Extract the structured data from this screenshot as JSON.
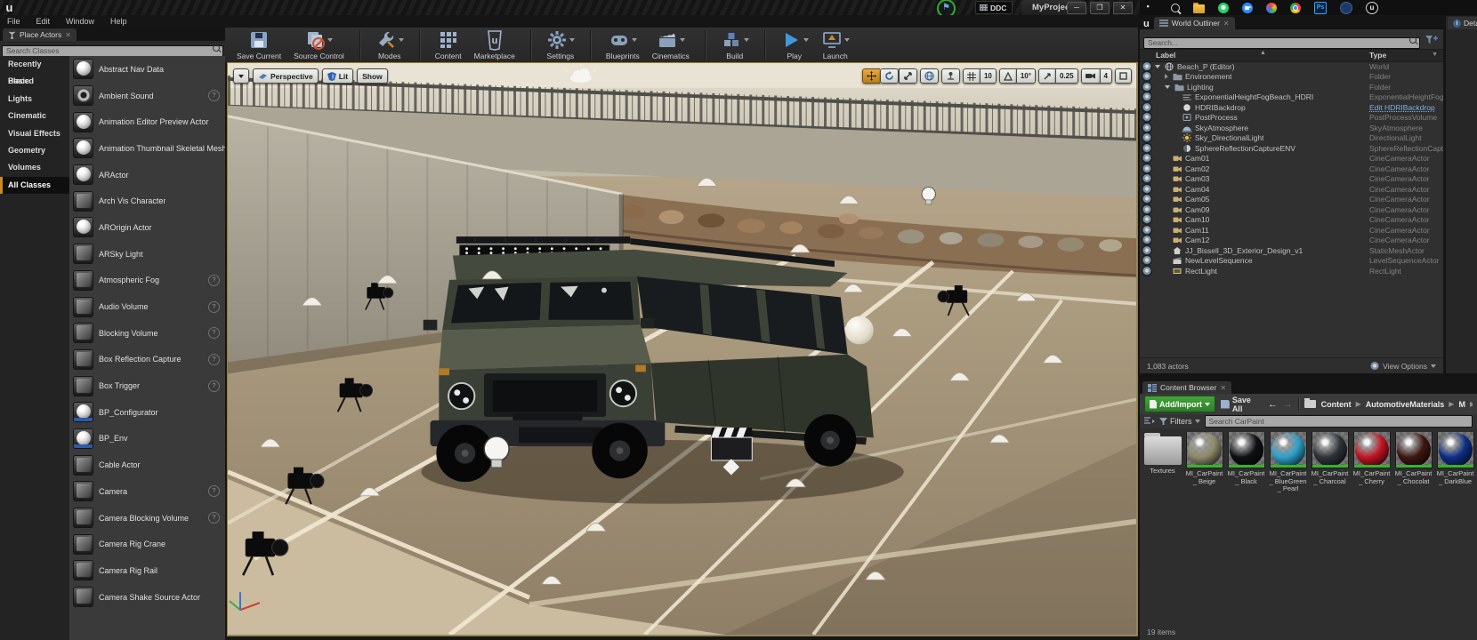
{
  "window": {
    "project_title": "MyProject",
    "ddc_label": "DDC",
    "menus": [
      "File",
      "Edit",
      "Window",
      "Help"
    ],
    "window_controls": [
      "minimize",
      "restore",
      "close"
    ]
  },
  "taskbar": {
    "icons": [
      "start",
      "search",
      "file-explorer",
      "whatsapp",
      "zoom",
      "photos",
      "chrome",
      "photoshop",
      "affinity",
      "unreal"
    ]
  },
  "place_actors": {
    "tab_label": "Place Actors",
    "search_placeholder": "Search Classes",
    "categories": [
      "Recently Placed",
      "Basic",
      "Lights",
      "Cinematic",
      "Visual Effects",
      "Geometry",
      "Volumes",
      "All Classes"
    ],
    "active_category": "All Classes",
    "items": [
      {
        "label": "Abstract Nav Data",
        "icon": "sphere",
        "help": false
      },
      {
        "label": "Ambient Sound",
        "icon": "speaker",
        "help": true
      },
      {
        "label": "Animation Editor Preview Actor",
        "icon": "sphere",
        "help": false
      },
      {
        "label": "Animation Thumbnail Skeletal Mesh",
        "icon": "sphere",
        "help": false
      },
      {
        "label": "ARActor",
        "icon": "sphere",
        "help": false
      },
      {
        "label": "Arch Vis Character",
        "icon": "dark",
        "help": false
      },
      {
        "label": "AROrigin Actor",
        "icon": "sphere",
        "help": false
      },
      {
        "label": "ARSky Light",
        "icon": "dark",
        "help": false
      },
      {
        "label": "Atmospheric Fog",
        "icon": "dark",
        "help": true
      },
      {
        "label": "Audio Volume",
        "icon": "dark",
        "help": true
      },
      {
        "label": "Blocking Volume",
        "icon": "dark",
        "help": true
      },
      {
        "label": "Box Reflection Capture",
        "icon": "dark",
        "help": true
      },
      {
        "label": "Box Trigger",
        "icon": "dark",
        "help": true
      },
      {
        "label": "BP_Configurator",
        "icon": "sphere bp",
        "help": false
      },
      {
        "label": "BP_Env",
        "icon": "sphere bp",
        "help": false
      },
      {
        "label": "Cable Actor",
        "icon": "dark",
        "help": false
      },
      {
        "label": "Camera",
        "icon": "dark",
        "help": true
      },
      {
        "label": "Camera Blocking Volume",
        "icon": "dark",
        "help": true
      },
      {
        "label": "Camera Rig Crane",
        "icon": "dark",
        "help": false
      },
      {
        "label": "Camera Rig Rail",
        "icon": "dark",
        "help": false
      },
      {
        "label": "Camera Shake Source Actor",
        "icon": "dark",
        "help": false
      }
    ]
  },
  "main_toolbar": {
    "buttons": [
      {
        "label": "Save Current",
        "icon": "save",
        "caret": false,
        "sep": false
      },
      {
        "label": "Source Control",
        "icon": "source",
        "caret": true,
        "sep": false
      },
      {
        "label": "Modes",
        "icon": "modes",
        "caret": true,
        "sep": true
      },
      {
        "label": "Content",
        "icon": "content",
        "caret": false,
        "sep": true
      },
      {
        "label": "Marketplace",
        "icon": "marketplace",
        "caret": false,
        "sep": false
      },
      {
        "label": "Settings",
        "icon": "settings",
        "caret": true,
        "sep": true
      },
      {
        "label": "Blueprints",
        "icon": "blueprints",
        "caret": true,
        "sep": true
      },
      {
        "label": "Cinematics",
        "icon": "cinematics",
        "caret": true,
        "sep": false
      },
      {
        "label": "Build",
        "icon": "build",
        "caret": true,
        "sep": true
      },
      {
        "label": "Play",
        "icon": "play",
        "caret": true,
        "sep": true
      },
      {
        "label": "Launch",
        "icon": "launch",
        "caret": true,
        "sep": false
      }
    ]
  },
  "viewport": {
    "perspective_label": "Perspective",
    "lit_label": "Lit",
    "show_label": "Show",
    "grid_snap_value": "10",
    "rotation_snap_value": "10°",
    "scale_snap_value": "0.25",
    "camera_speed_value": "4"
  },
  "outliner": {
    "tab_label": "World Outliner",
    "search_placeholder": "Search...",
    "label_column": "Label",
    "type_column": "Type",
    "footer_count": "1,083 actors",
    "view_options_label": "View Options",
    "rows": [
      {
        "label": "Beach_P (Editor)",
        "type": "World",
        "depth": 0,
        "icon": "world",
        "expand": "open",
        "link": false
      },
      {
        "label": "Environement",
        "type": "Folder",
        "depth": 1,
        "icon": "folder",
        "expand": "closed",
        "link": false
      },
      {
        "label": "Lighting",
        "type": "Folder",
        "depth": 1,
        "icon": "folder",
        "expand": "open",
        "link": false
      },
      {
        "label": "ExponentialHeightFogBeach_HDRI",
        "type": "ExponentialHeightFog",
        "depth": 2,
        "icon": "fog",
        "expand": "none",
        "link": false
      },
      {
        "label": "HDRIBackdrop",
        "type": "Edit HDRIBackdrop",
        "depth": 2,
        "icon": "hdri",
        "expand": "none",
        "link": true
      },
      {
        "label": "PostProcess",
        "type": "PostProcessVolume",
        "depth": 2,
        "icon": "post",
        "expand": "none",
        "link": false
      },
      {
        "label": "SkyAtmosphere",
        "type": "SkyAtmosphere",
        "depth": 2,
        "icon": "sky",
        "expand": "none",
        "link": false
      },
      {
        "label": "Sky_DirectionalLight",
        "type": "DirectionalLight",
        "depth": 2,
        "icon": "sun",
        "expand": "none",
        "link": false
      },
      {
        "label": "SphereReflectionCaptureENV",
        "type": "SphereReflectionCapture",
        "depth": 2,
        "icon": "refl",
        "expand": "none",
        "link": false
      },
      {
        "label": "Cam01",
        "type": "CineCameraActor",
        "depth": 1,
        "icon": "cam",
        "expand": "none",
        "link": false
      },
      {
        "label": "Cam02",
        "type": "CineCameraActor",
        "depth": 1,
        "icon": "cam",
        "expand": "none",
        "link": false
      },
      {
        "label": "Cam03",
        "type": "CineCameraActor",
        "depth": 1,
        "icon": "cam",
        "expand": "none",
        "link": false
      },
      {
        "label": "Cam04",
        "type": "CineCameraActor",
        "depth": 1,
        "icon": "cam",
        "expand": "none",
        "link": false
      },
      {
        "label": "Cam05",
        "type": "CineCameraActor",
        "depth": 1,
        "icon": "cam",
        "expand": "none",
        "link": false
      },
      {
        "label": "Cam09",
        "type": "CineCameraActor",
        "depth": 1,
        "icon": "cam",
        "expand": "none",
        "link": false
      },
      {
        "label": "Cam10",
        "type": "CineCameraActor",
        "depth": 1,
        "icon": "cam",
        "expand": "none",
        "link": false
      },
      {
        "label": "Cam11",
        "type": "CineCameraActor",
        "depth": 1,
        "icon": "cam",
        "expand": "none",
        "link": false
      },
      {
        "label": "Cam12",
        "type": "CineCameraActor",
        "depth": 1,
        "icon": "cam",
        "expand": "none",
        "link": false
      },
      {
        "label": "JJ_Bissell_3D_Exterior_Design_v1",
        "type": "StaticMeshActor",
        "depth": 1,
        "icon": "mesh",
        "expand": "none",
        "link": false
      },
      {
        "label": "NewLevelSequence",
        "type": "LevelSequenceActor",
        "depth": 1,
        "icon": "seq",
        "expand": "none",
        "link": false
      },
      {
        "label": "RectLight",
        "type": "RectLight",
        "depth": 1,
        "icon": "rect",
        "expand": "none",
        "link": false
      }
    ]
  },
  "details": {
    "tab_label": "Details"
  },
  "content_browser": {
    "tab_label": "Content Browser",
    "add_import_label": "Add/Import",
    "save_all_label": "Save All",
    "breadcrumbs": [
      "Content",
      "AutomotiveMaterials",
      "M"
    ],
    "filters_label": "Filters",
    "search_placeholder": "Search CarPaint",
    "footer_count": "19 items",
    "assets": [
      {
        "label": "Textures",
        "kind": "folder",
        "color": ""
      },
      {
        "label": "MI_CarPaint_ Beige",
        "kind": "material",
        "color": "#8d8a6a"
      },
      {
        "label": "MI_CarPaint_ Black",
        "kind": "material",
        "color": "#0e1013"
      },
      {
        "label": "MI_CarPaint_ BlueGreen_ Pearl",
        "kind": "material",
        "color": "#2f9fc9"
      },
      {
        "label": "MI_CarPaint_ Charcoal",
        "kind": "material",
        "color": "#2e3338"
      },
      {
        "label": "MI_CarPaint_ Cherry",
        "kind": "material",
        "color": "#c01421"
      },
      {
        "label": "MI_CarPaint_ Chocolat",
        "kind": "material",
        "color": "#3d1712"
      },
      {
        "label": "MI_CarPaint_ DarkBlue",
        "kind": "material",
        "color": "#0d2f85"
      }
    ]
  }
}
